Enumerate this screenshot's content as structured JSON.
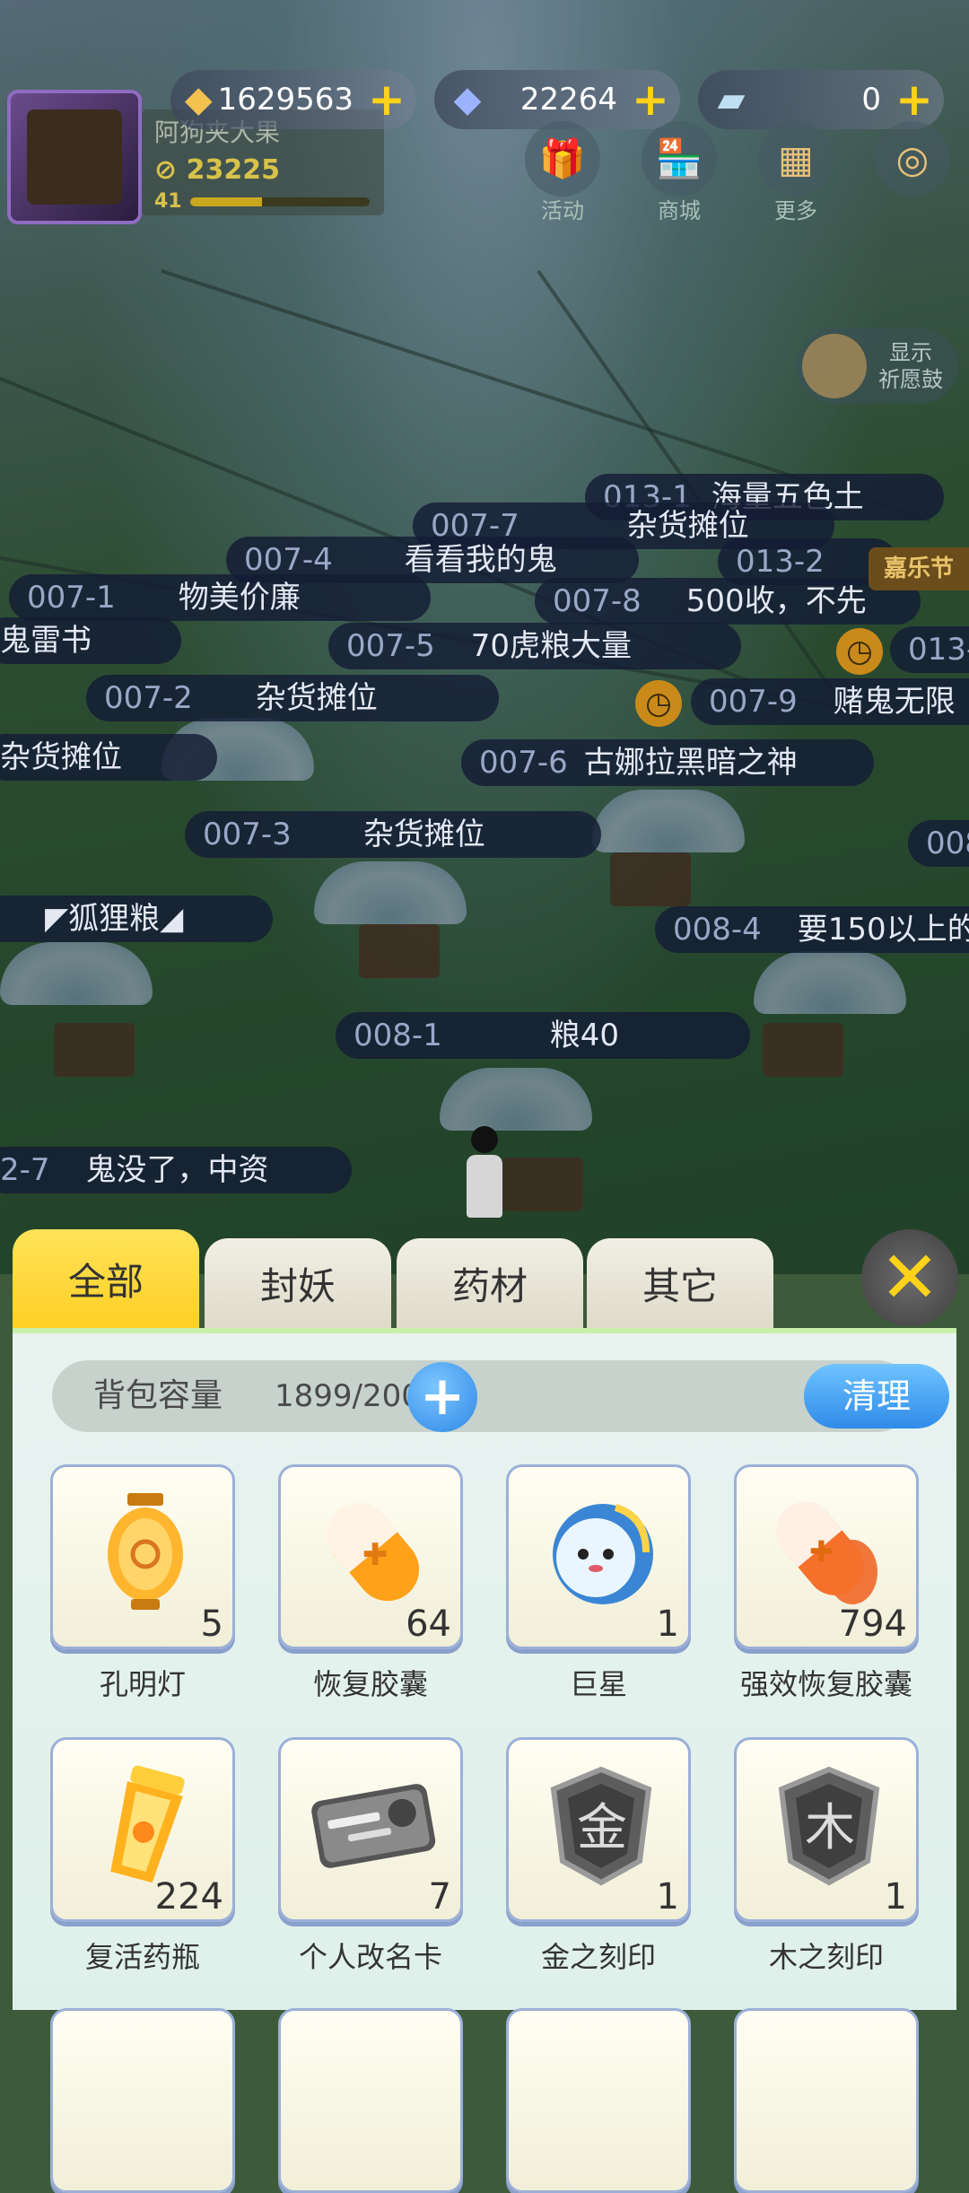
{
  "resources": [
    {
      "name": "crystal",
      "icon": "crystal-icon",
      "value": "1629563"
    },
    {
      "name": "diamond",
      "icon": "diamond-icon",
      "value": "22264"
    },
    {
      "name": "ticket",
      "icon": "ticket-icon",
      "value": "0"
    }
  ],
  "player": {
    "name": "阿狗夹大果",
    "power": "23225",
    "level": "41"
  },
  "hud_buttons": [
    "活动",
    "商城",
    "更多"
  ],
  "wish": {
    "label_line1": "显示",
    "label_line2": "祈愿鼓"
  },
  "festival_tag": "嘉乐节",
  "stalls": [
    {
      "code": "013-1",
      "name": "海量五色土"
    },
    {
      "code": "007-7",
      "name": "杂货摊位"
    },
    {
      "code": "007-4",
      "name": "看看我的鬼"
    },
    {
      "code": "013-2",
      "name": ""
    },
    {
      "code": "007-1",
      "name": "物美价廉"
    },
    {
      "code": "007-8",
      "name": "500收，不先"
    },
    {
      "code": "",
      "name": "鬼雷书"
    },
    {
      "code": "007-5",
      "name": "70虎粮大量"
    },
    {
      "code": "013-",
      "name": ""
    },
    {
      "code": "007-2",
      "name": "杂货摊位"
    },
    {
      "code": "007-9",
      "name": "赌鬼无限"
    },
    {
      "code": "",
      "name": "杂货摊位"
    },
    {
      "code": "007-6",
      "name": "古娜拉黑暗之神"
    },
    {
      "code": "007-3",
      "name": "杂货摊位"
    },
    {
      "code": "008",
      "name": ""
    },
    {
      "code": "",
      "name": "◤狐狸粮◢"
    },
    {
      "code": "008-4",
      "name": "要150以上的"
    },
    {
      "code": "008-1",
      "name": "粮40"
    },
    {
      "code": "2-7",
      "name": "鬼没了，中资"
    }
  ],
  "tabs": [
    "全部",
    "封妖",
    "药材",
    "其它"
  ],
  "capacity": {
    "label": "背包容量",
    "count": "1899/2000",
    "clean": "清理"
  },
  "items": [
    {
      "name": "孔明灯",
      "qty": "5",
      "icon": "lantern-icon"
    },
    {
      "name": "恢复胶囊",
      "qty": "64",
      "icon": "capsule-icon"
    },
    {
      "name": "巨星",
      "qty": "1",
      "icon": "star-creature-icon"
    },
    {
      "name": "强效恢复胶囊",
      "qty": "794",
      "icon": "strong-capsule-icon"
    },
    {
      "name": "复活药瓶",
      "qty": "224",
      "icon": "revive-bottle-icon"
    },
    {
      "name": "个人改名卡",
      "qty": "7",
      "icon": "rename-card-icon"
    },
    {
      "name": "金之刻印",
      "qty": "1",
      "icon": "metal-seal-icon"
    },
    {
      "name": "木之刻印",
      "qty": "1",
      "icon": "wood-seal-icon"
    }
  ]
}
